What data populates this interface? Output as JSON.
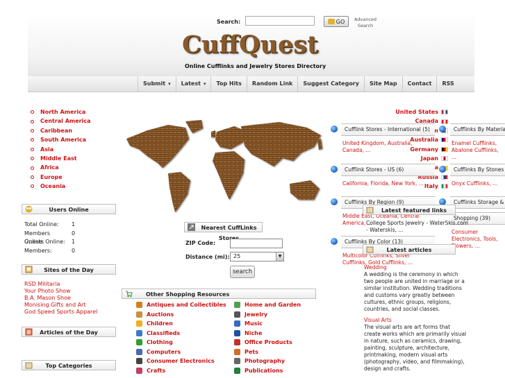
{
  "header": {
    "search_label": "Search:",
    "search_placeholder": "",
    "go_label": "GO",
    "advanced_search": "Advanced Search",
    "logo": "CuffQuest",
    "tagline": "Online Cufflinks and Jewelry Stores Directory"
  },
  "nav": [
    {
      "label": "Submit",
      "dropdown": true
    },
    {
      "label": "Latest",
      "dropdown": true
    },
    {
      "label": "Top Hits",
      "dropdown": false
    },
    {
      "label": "Random Link",
      "dropdown": false
    },
    {
      "label": "Suggest Category",
      "dropdown": false
    },
    {
      "label": "Site Map",
      "dropdown": false
    },
    {
      "label": "Contact",
      "dropdown": false
    },
    {
      "label": "RSS",
      "dropdown": false
    }
  ],
  "regions": [
    "North America",
    "Central America",
    "Caribbean",
    "South America",
    "Asia",
    "Middle East",
    "Africa",
    "Europe",
    "Oceania"
  ],
  "countries": [
    {
      "name": "United States",
      "flag_colors": [
        "#b22234",
        "#ffffff",
        "#3c3b6e"
      ]
    },
    {
      "name": "Canada",
      "flag_colors": [
        "#ff0000",
        "#ffffff",
        "#ff0000"
      ]
    },
    {
      "name": "United Kingdom",
      "flag_colors": [
        "#012169",
        "#c8102e",
        "#ffffff"
      ]
    },
    {
      "name": "Australia",
      "flag_colors": [
        "#00008b",
        "#ff0000",
        "#ffffff"
      ]
    },
    {
      "name": "Germany",
      "flag_colors": [
        "#000000",
        "#dd0000",
        "#ffce00"
      ]
    },
    {
      "name": "Japan",
      "flag_colors": [
        "#ffffff",
        "#bc002d",
        "#ffffff"
      ]
    },
    {
      "name": "China",
      "flag_colors": [
        "#de2910",
        "#de2910",
        "#ffde00"
      ]
    },
    {
      "name": "Russia",
      "flag_colors": [
        "#ffffff",
        "#0039a6",
        "#d52b1e"
      ]
    },
    {
      "name": "Italy",
      "flag_colors": [
        "#009246",
        "#ffffff",
        "#ce2b37"
      ]
    }
  ],
  "users_online": {
    "title": "Users Online",
    "stats": [
      {
        "label": "Total Online:",
        "value": "1"
      },
      {
        "label": "Members Online:",
        "value": "0"
      },
      {
        "label": "Guests Online:",
        "value": "1"
      },
      {
        "label": "Members:",
        "value": "0"
      }
    ]
  },
  "sites_of_day": {
    "title": "Sites of the Day",
    "items": [
      "RSD Militaria",
      "Your Photo Show",
      "B.A. Mason Shoe",
      "Monising Gifts and Art",
      "God Speed Sports Apparel"
    ]
  },
  "articles_of_day": {
    "title": "Articles of the Day"
  },
  "top_categories": {
    "title": "Top Categories"
  },
  "nearest": {
    "title": "Nearest CuffLinks Stores",
    "zip_label": "ZIP Code:",
    "distance_label": "Distance (mi):",
    "distance_value": "25",
    "search_button": "search"
  },
  "shopping": {
    "title": "Other Shopping Resources",
    "left": [
      {
        "label": "Antiques and Collectibles",
        "color": "#d08020"
      },
      {
        "label": "Auctions",
        "color": "#c89040"
      },
      {
        "label": "Children",
        "color": "#f0b020"
      },
      {
        "label": "Classifieds",
        "color": "#3a7ac8"
      },
      {
        "label": "Clothing",
        "color": "#30a030"
      },
      {
        "label": "Computers",
        "color": "#4a6ab0"
      },
      {
        "label": "Consumer Electronics",
        "color": "#444444"
      },
      {
        "label": "Crafts",
        "color": "#c04060"
      }
    ],
    "right": [
      {
        "label": "Home and Garden",
        "color": "#50a050"
      },
      {
        "label": "Jewelry",
        "color": "#555555"
      },
      {
        "label": "Music",
        "color": "#3a6ac0"
      },
      {
        "label": "Niche",
        "color": "#2050a0"
      },
      {
        "label": "Office Products",
        "color": "#c03030"
      },
      {
        "label": "Pets",
        "color": "#d07020"
      },
      {
        "label": "Photography",
        "color": "#666666"
      },
      {
        "label": "Publications",
        "color": "#208040"
      }
    ]
  },
  "cat_col1": [
    {
      "title": "Cufflink Stores - International (5)",
      "links": "United Kingdom, Australia, Canada, ..."
    },
    {
      "title": "Cufflink Stores - US (6)",
      "links": "California, Florida, New York, ..."
    },
    {
      "title": "Cufflinks By Region (9)",
      "links": "Middle East, Oceania, Central America, ..."
    },
    {
      "title": "Cufflinks By Color (13)",
      "links": "Multicolor Cufflinks, Silver Cufflinks, Gold Cufflinks, ..."
    }
  ],
  "cat_col2": [
    {
      "title": "Cufflinks By Material",
      "links": "Enamel Cufflinks, Abalone Cufflinks, ..."
    },
    {
      "title": "Cufflinks By Stones",
      "links": "Onyx Cufflinks, ..."
    },
    {
      "title": "Cufflinks Storage & ...",
      "links": ""
    },
    {
      "title": "Shopping (39)",
      "links": "Consumer Electronics, Tools, Flowers, ..."
    }
  ],
  "featured": {
    "title": "Latest featured links",
    "text": "College Sports Jewelry - WaterSkis.com - Waterskis, ..."
  },
  "latest_articles": {
    "title": "Latest articles",
    "items": [
      {
        "title": "Wedding",
        "body": "A wedding is the ceremony in which two people are united in marriage or a similar institution. Wedding traditions and customs vary greatly between cultures, ethnic groups, religions, countries, and social classes."
      },
      {
        "title": "Visual Arts",
        "body": "The visual arts are art forms that create works which are primarily visual in nature, such as ceramics, drawing, painting, sculpture, architecture, printmaking, modern visual arts (photography, video, and filmmaking), design and crafts."
      }
    ]
  },
  "colors": {
    "accent": "#cc1111",
    "logo": "#8a5a2b"
  }
}
